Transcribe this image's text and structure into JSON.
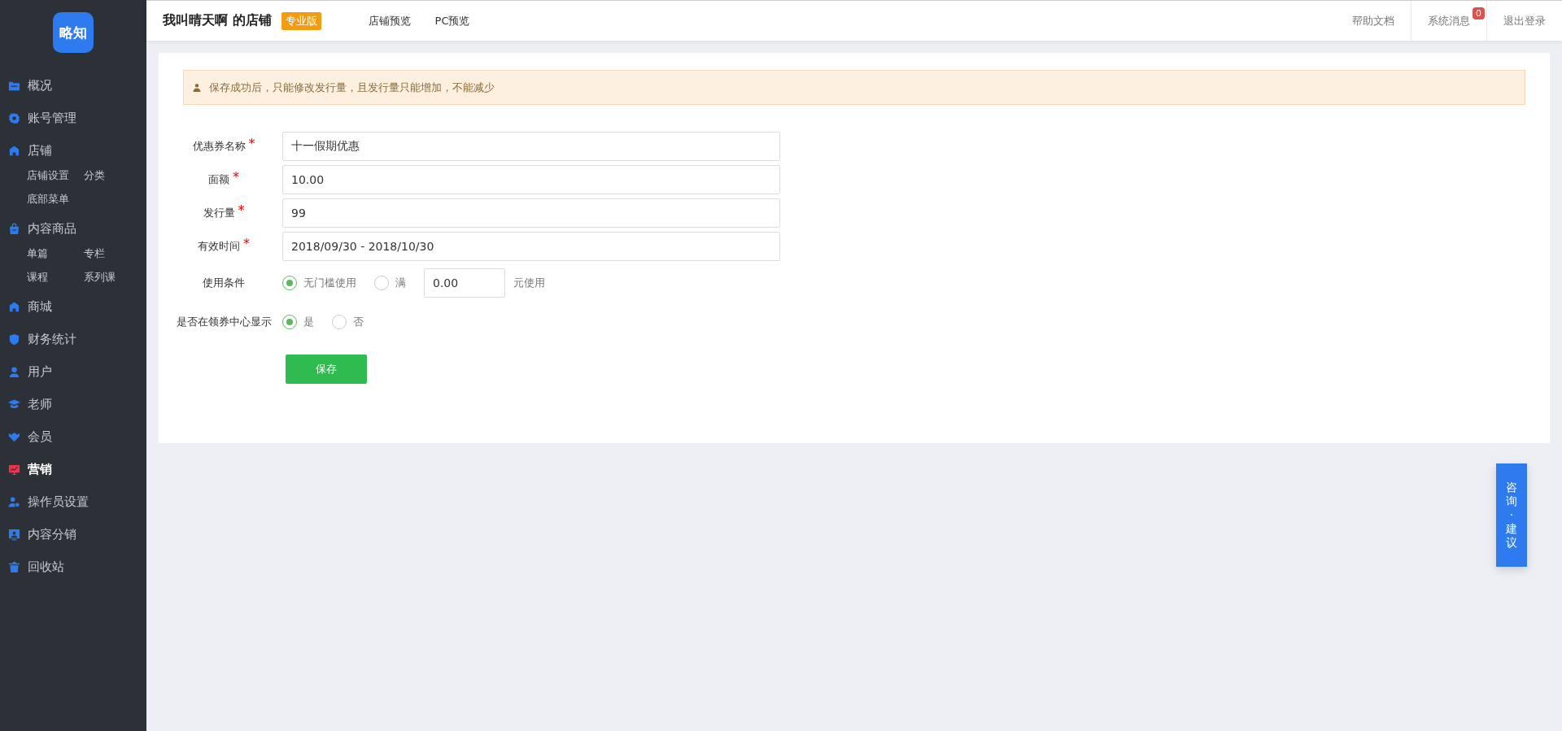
{
  "sidebar": {
    "logo": "略知",
    "items": [
      {
        "label": "概况",
        "selected": false
      },
      {
        "label": "账号管理",
        "selected": false
      },
      {
        "label": "店铺",
        "selected": false,
        "children": [
          {
            "label": "店铺设置",
            "selected": false
          },
          {
            "label": "分类",
            "selected": false
          },
          {
            "label": "底部菜单",
            "selected": false
          }
        ]
      },
      {
        "label": "内容商品",
        "selected": false,
        "children": [
          {
            "label": "单篇",
            "selected": false
          },
          {
            "label": "专栏",
            "selected": false
          },
          {
            "label": "课程",
            "selected": false
          },
          {
            "label": "系列课",
            "selected": false
          }
        ]
      },
      {
        "label": "商城",
        "selected": false
      },
      {
        "label": "财务统计",
        "selected": false
      },
      {
        "label": "用户",
        "selected": false
      },
      {
        "label": "老师",
        "selected": false
      },
      {
        "label": "会员",
        "selected": false
      },
      {
        "label": "营销",
        "selected": true
      },
      {
        "label": "操作员设置",
        "selected": false
      },
      {
        "label": "内容分销",
        "selected": false
      },
      {
        "label": "回收站",
        "selected": false
      }
    ]
  },
  "header": {
    "shop_name": "我叫晴天啊 的店铺",
    "edition_badge": "专业版",
    "links": [
      "店铺预览",
      "PC预览"
    ],
    "right_links": [
      {
        "label": "帮助文档"
      },
      {
        "label": "系统消息",
        "badge": "0"
      },
      {
        "label": "退出登录"
      }
    ]
  },
  "notice": "保存成功后，只能修改发行量，且发行量只能增加，不能减少",
  "form": {
    "fields": [
      {
        "label": "优惠券名称",
        "mark": "*",
        "value": "十一假期优惠"
      },
      {
        "label": "面额",
        "mark": "*",
        "value": "10.00"
      },
      {
        "label": "发行量",
        "mark": "*",
        "value": "99"
      },
      {
        "label": "有效时间",
        "mark": "*",
        "value": "2018/09/30 - 2018/10/30"
      }
    ],
    "condition": {
      "label": "使用条件",
      "options": [
        {
          "label": "无门槛使用",
          "selected": true
        },
        {
          "label": "满",
          "selected": false
        }
      ],
      "amount": "0.00",
      "suffix": "元使用"
    },
    "show_in_center": {
      "label": "是否在领券中心显示",
      "options": [
        {
          "label": "是",
          "selected": true
        },
        {
          "label": "否",
          "selected": false
        }
      ]
    },
    "save_button": "保存"
  },
  "float_button": {
    "chars": [
      "咨",
      "询",
      "·",
      "建",
      "议"
    ]
  }
}
